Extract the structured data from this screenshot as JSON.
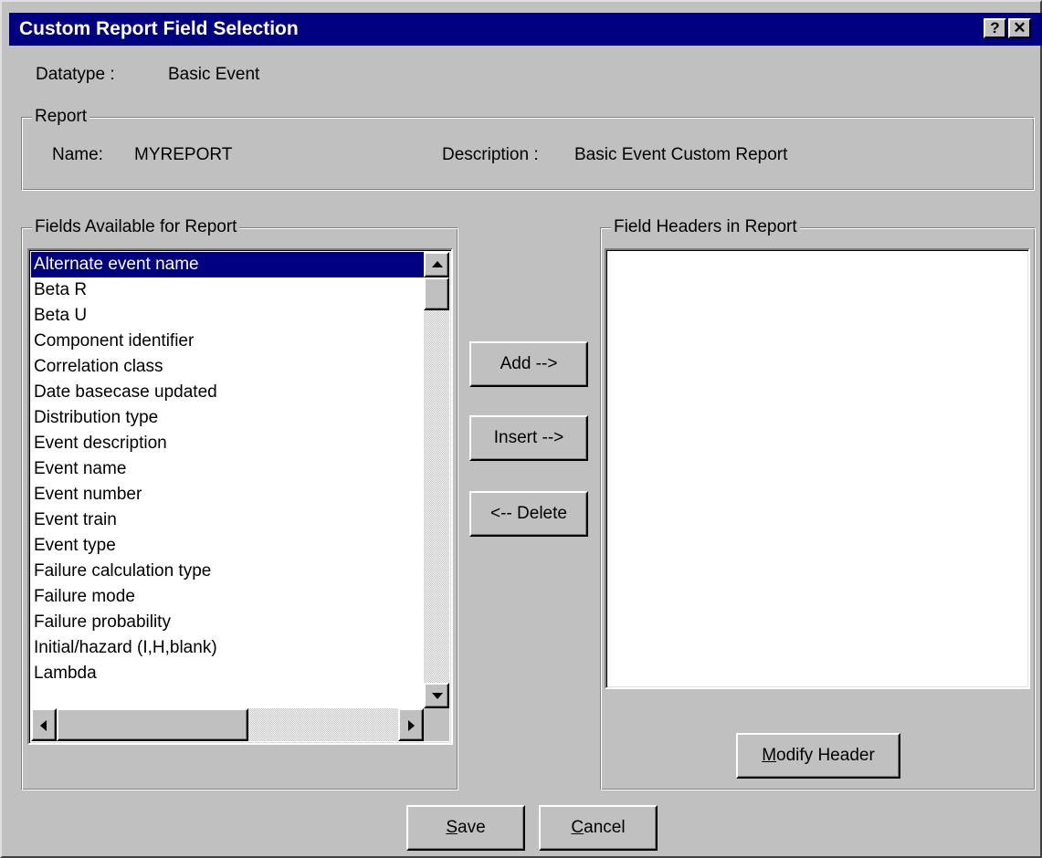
{
  "window": {
    "title": "Custom Report Field Selection",
    "help_glyph": "?",
    "close_glyph": "✕"
  },
  "datatype": {
    "label": "Datatype :",
    "value": "Basic Event"
  },
  "report": {
    "legend": "Report",
    "name_label": "Name:",
    "name_value": "MYREPORT",
    "description_label": "Description :",
    "description_value": "Basic Event Custom Report"
  },
  "available": {
    "legend": "Fields Available for Report",
    "items": [
      "Alternate event name",
      "Beta R",
      "Beta U",
      "Component identifier",
      "Correlation class",
      "Date basecase updated",
      "Distribution type",
      "Event description",
      "Event name",
      "Event number",
      "Event train",
      "Event type",
      "Failure calculation type",
      "Failure mode",
      "Failure probability",
      "Initial/hazard (I,H,blank)",
      "Lambda"
    ],
    "selected_index": 0
  },
  "headers": {
    "legend": "Field Headers in Report",
    "items": []
  },
  "buttons": {
    "add": "Add -->",
    "insert": "Insert -->",
    "delete": "<-- Delete",
    "modify_header": "Modify Header",
    "save": "Save",
    "cancel": "Cancel"
  }
}
